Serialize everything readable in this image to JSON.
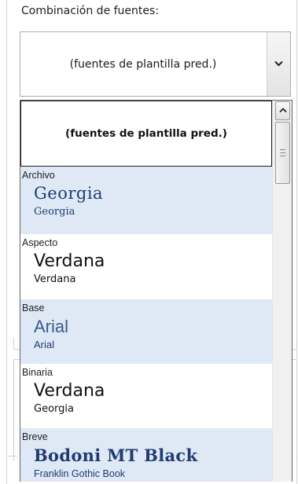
{
  "field_label": "Combinación de fuentes:",
  "combo": {
    "value": "(fuentes de plantilla pred.)",
    "dropdown_icon": "chevron-down-icon"
  },
  "list": {
    "selected_item": "(fuentes de plantilla pred.)",
    "items": [
      {
        "name": "Archivo",
        "heading_font": "Georgia",
        "body_font": "Georgia"
      },
      {
        "name": "Aspecto",
        "heading_font": "Verdana",
        "body_font": "Verdana"
      },
      {
        "name": "Base",
        "heading_font": "Arial",
        "body_font": "Arial"
      },
      {
        "name": "Binaria",
        "heading_font": "Verdana",
        "body_font": "Georgia"
      },
      {
        "name": "Breve",
        "heading_font": "Bodoni MT Black",
        "body_font": "Franklin Gothic Book"
      }
    ]
  },
  "scrollbar": {
    "up_icon": "chevron-up-icon",
    "thumb_icon": "grip-lines-icon"
  },
  "colors": {
    "alt_row": "#dfe9f6",
    "heading_serif": "#1f3b70"
  }
}
